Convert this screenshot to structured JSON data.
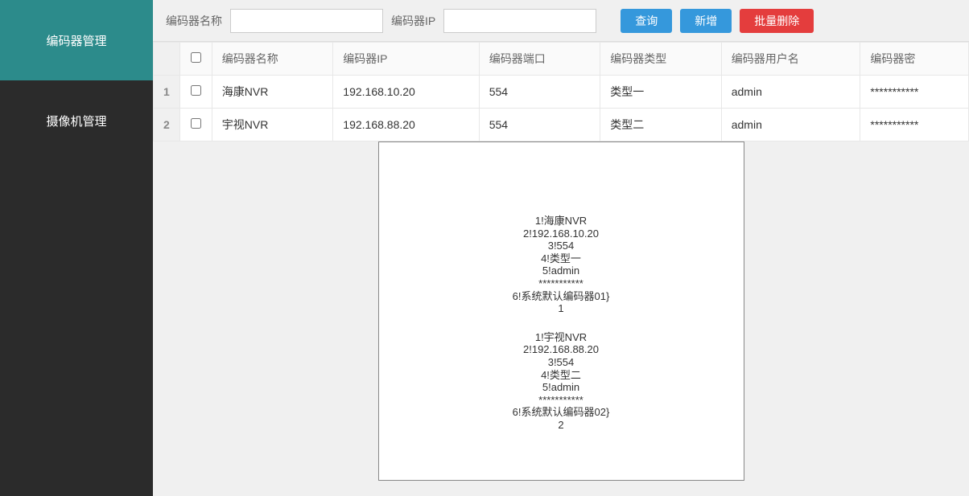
{
  "sidebar": {
    "items": [
      {
        "label": "编码器管理",
        "active": true
      },
      {
        "label": "摄像机管理",
        "active": false
      }
    ]
  },
  "toolbar": {
    "name_label": "编码器名称",
    "ip_label": "编码器IP",
    "name_value": "",
    "ip_value": "",
    "query_label": "查询",
    "add_label": "新增",
    "batch_delete_label": "批量删除"
  },
  "table": {
    "headers": {
      "name": "编码器名称",
      "ip": "编码器IP",
      "port": "编码器端口",
      "type": "编码器类型",
      "user": "编码器用户名",
      "pass": "编码器密"
    },
    "rows": [
      {
        "num": "1",
        "name": "海康NVR",
        "ip": "192.168.10.20",
        "port": "554",
        "type": "类型一",
        "user": "admin",
        "pass": "***********"
      },
      {
        "num": "2",
        "name": "宇视NVR",
        "ip": "192.168.88.20",
        "port": "554",
        "type": "类型二",
        "user": "admin",
        "pass": "***********"
      }
    ]
  },
  "debug": {
    "blocks": [
      {
        "lines": [
          "1!海康NVR",
          "2!192.168.10.20",
          "3!554",
          "4!类型一",
          "5!admin",
          "***********",
          "6!系统默认编码器01}",
          "1"
        ]
      },
      {
        "lines": [
          "1!宇视NVR",
          "2!192.168.88.20",
          "3!554",
          "4!类型二",
          "5!admin",
          "***********",
          "6!系统默认编码器02}",
          "2"
        ]
      }
    ]
  }
}
